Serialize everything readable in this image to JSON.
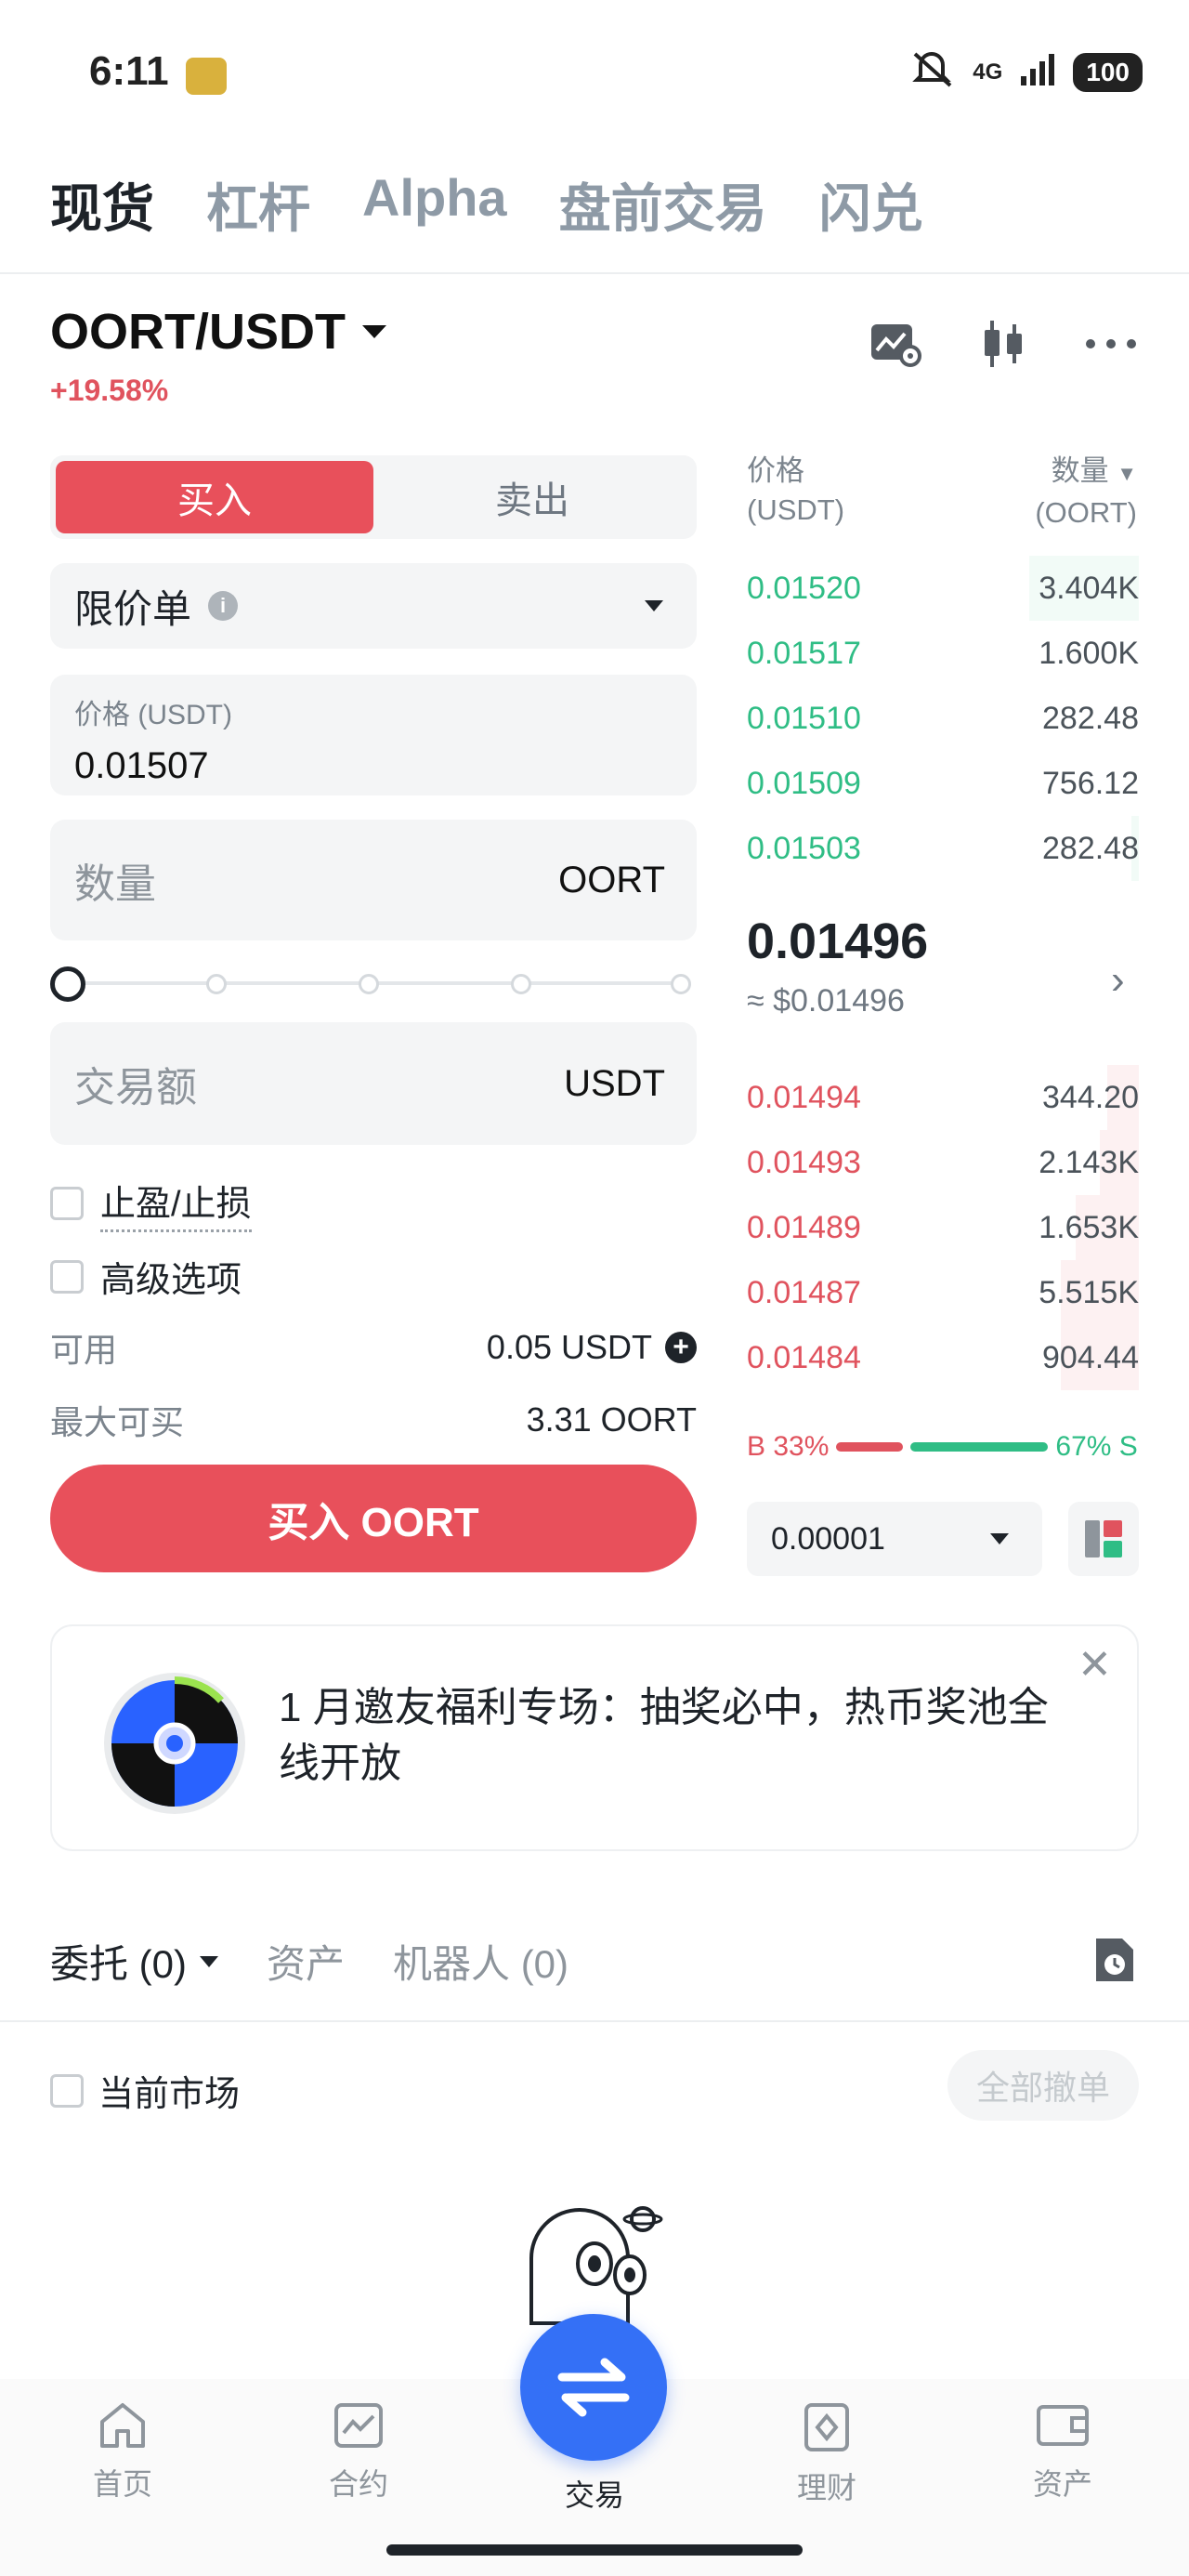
{
  "status": {
    "time": "6:11",
    "network": "4G",
    "battery": "100"
  },
  "top_tabs": [
    "现货",
    "杠杆",
    "Alpha",
    "盘前交易",
    "闪兑"
  ],
  "pair": {
    "name": "OORT/USDT",
    "change": "+19.58%"
  },
  "trade": {
    "buy_label": "买入",
    "sell_label": "卖出",
    "order_type": "限价单",
    "price_label": "价格 (USDT)",
    "price_value": "0.01507",
    "qty_placeholder": "数量",
    "qty_unit": "OORT",
    "amount_placeholder": "交易额",
    "amount_unit": "USDT",
    "tpsl_label": "止盈/止损",
    "advanced_label": "高级选项",
    "available_label": "可用",
    "available_value": "0.05 USDT",
    "max_buy_label": "最大可买",
    "max_buy_value": "3.31 OORT",
    "submit_label": "买入 OORT",
    "slider_percent": 0
  },
  "orderbook": {
    "price_header_1": "价格",
    "price_header_2": "(USDT)",
    "qty_header_1": "数量",
    "qty_header_2": "(OORT)",
    "asks": [
      {
        "price": "0.01520",
        "qty": "3.404K",
        "depth": 0.28
      },
      {
        "price": "0.01517",
        "qty": "1.600K",
        "depth": 0.0
      },
      {
        "price": "0.01510",
        "qty": "282.48",
        "depth": 0.0
      },
      {
        "price": "0.01509",
        "qty": "756.12",
        "depth": 0.0
      },
      {
        "price": "0.01503",
        "qty": "282.48",
        "depth": 0.02
      }
    ],
    "last_price": "0.01496",
    "last_price_usd": "≈ $0.01496",
    "bids": [
      {
        "price": "0.01494",
        "qty": "344.20",
        "depth": 0.08
      },
      {
        "price": "0.01493",
        "qty": "2.143K",
        "depth": 0.1
      },
      {
        "price": "0.01489",
        "qty": "1.653K",
        "depth": 0.16
      },
      {
        "price": "0.01487",
        "qty": "5.515K",
        "depth": 0.2
      },
      {
        "price": "0.01484",
        "qty": "904.44",
        "depth": 0.2
      }
    ],
    "buy_ratio_label": "B 33%",
    "sell_ratio_label": "67% S",
    "buy_ratio": 0.33,
    "precision": "0.00001"
  },
  "promo": {
    "text": "1 月邀友福利专场：抽奖必中，热币奖池全线开放"
  },
  "orders": {
    "tab_orders": "委托 (0)",
    "tab_assets": "资产",
    "tab_bots": "机器人 (0)",
    "current_market": "当前市场",
    "cancel_all": "全部撤单"
  },
  "nav": [
    "首页",
    "合约",
    "交易",
    "理财",
    "资产"
  ],
  "colors": {
    "buy": "#e8505b",
    "ask_green": "#2fbd85",
    "bid_red": "#e0535e",
    "fab_blue": "#3470f6"
  }
}
